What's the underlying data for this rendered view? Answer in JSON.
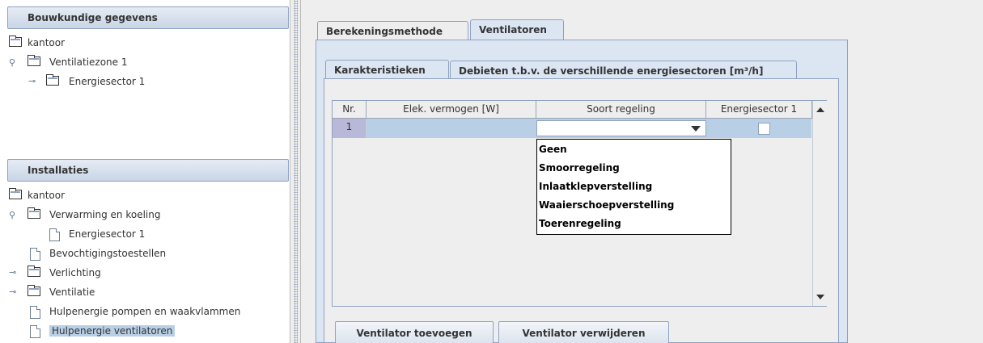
{
  "left_panel": {
    "bouwkundig": {
      "header": "Bouwkundige gegevens",
      "root": "kantoor",
      "zone": "Ventilatiezone 1",
      "sector": "Energiesector 1"
    },
    "installaties": {
      "header": "Installaties",
      "root": "kantoor",
      "items": [
        "Verwarming en koeling",
        "Energiesector 1",
        "Bevochtigingstoestellen",
        "Verlichting",
        "Ventilatie",
        "Hulpenergie pompen en waakvlammen",
        "Hulpenergie ventilatoren"
      ]
    }
  },
  "tabs": {
    "outer": [
      "Berekeningsmethode",
      "Ventilatoren"
    ],
    "inner": [
      "Karakteristieken",
      "Debieten t.b.v. de verschillende energiesectoren [m³/h]"
    ]
  },
  "table": {
    "headers": [
      "Nr.",
      "Elek. vermogen [W]",
      "Soort regeling",
      "Energiesector 1"
    ],
    "rows": [
      {
        "nr": "1",
        "vermogen": "",
        "regeling": "",
        "energiesector": false
      }
    ]
  },
  "dropdown": {
    "options": [
      "Geen",
      "Smoorregeling",
      "Inlaatklepverstelling",
      "Waaierschoepverstelling",
      "Toerenregeling"
    ]
  },
  "buttons": {
    "add": "Ventilator toevoegen",
    "remove": "Ventilator verwijderen"
  },
  "colors": {
    "header_gradient_top": "#e6ecf5",
    "header_gradient_bottom": "#c9d5e6",
    "border": "#8ea2bf",
    "selected_row": "#b8cfe5",
    "tab_active": "#dce6f3"
  }
}
